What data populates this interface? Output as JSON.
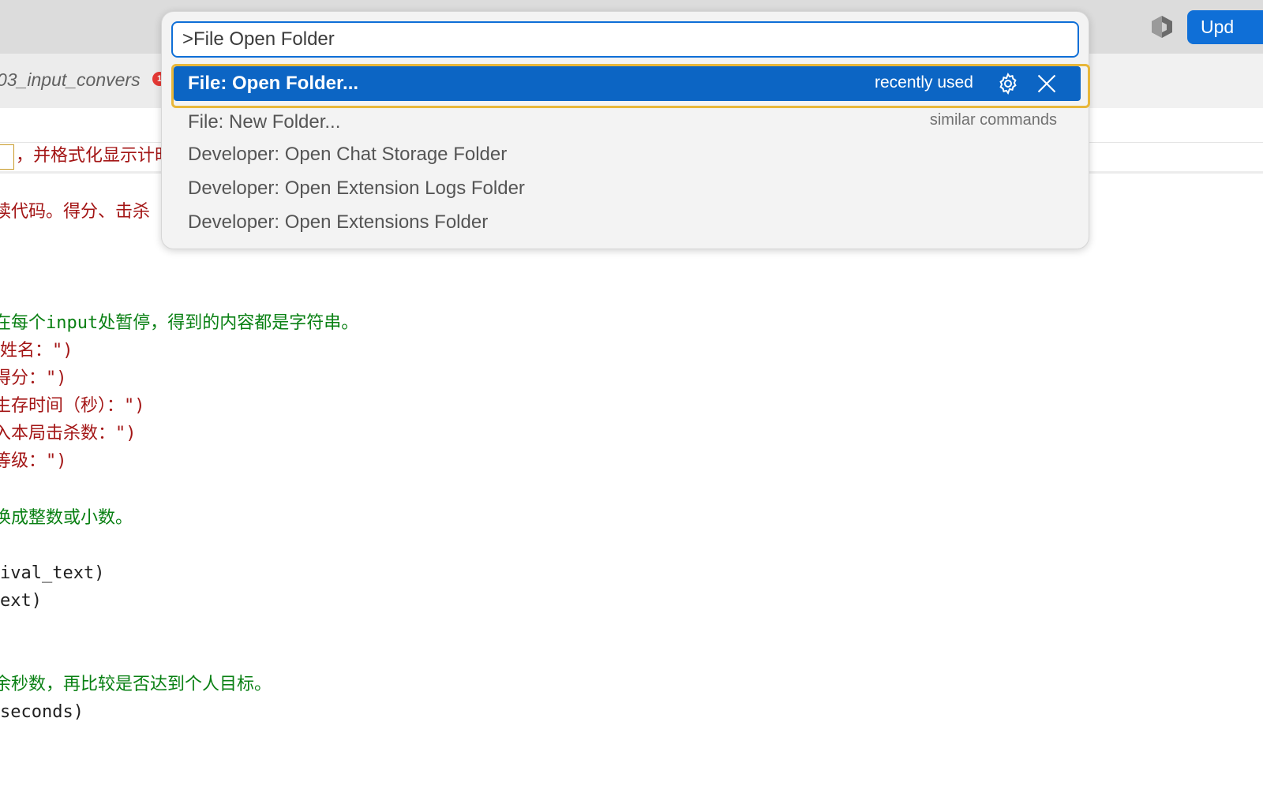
{
  "titlebar": {
    "update_button": "Upd",
    "copilot_icon": "copilot-icon"
  },
  "tabs": [
    {
      "label": "03_input_convers",
      "badge": "1"
    }
  ],
  "editor": {
    "sticky_line": "，并格式化显示计时",
    "lines": [
      {
        "text": "读代码。得分、击杀",
        "color": "red"
      },
      {
        "text": "在每个input处暂停，得到的内容都是字符串。",
        "color": "green"
      },
      {
        "text": "姓名：\")",
        "color": "red"
      },
      {
        "text": "得分：\")",
        "color": "red"
      },
      {
        "text": "生存时间（秒）：\")",
        "color": "red"
      },
      {
        "text": "入本局击杀数：\")",
        "color": "red"
      },
      {
        "text": "等级：\")",
        "color": "red"
      },
      {
        "text": "换成整数或小数。",
        "color": "green"
      },
      {
        "text": "ival_text)",
        "color": "black"
      },
      {
        "text": "ext)",
        "color": "black"
      },
      {
        "text": "余秒数，再比较是否达到个人目标。",
        "color": "green"
      },
      {
        "text": "seconds)",
        "color": "black"
      }
    ]
  },
  "palette": {
    "input_value": ">File Open Folder",
    "selected": {
      "label": "File: Open Folder...",
      "meta": "recently used",
      "gear_icon": "gear-icon",
      "close_icon": "close-icon"
    },
    "items": [
      {
        "label": "File: New Folder...",
        "meta": "similar commands"
      },
      {
        "label": "Developer: Open Chat Storage Folder"
      },
      {
        "label": "Developer: Open Extension Logs Folder"
      },
      {
        "label": "Developer: Open Extensions Folder"
      }
    ],
    "colors": {
      "accent": "#0c65c4",
      "focus": "#e8b73a"
    }
  }
}
